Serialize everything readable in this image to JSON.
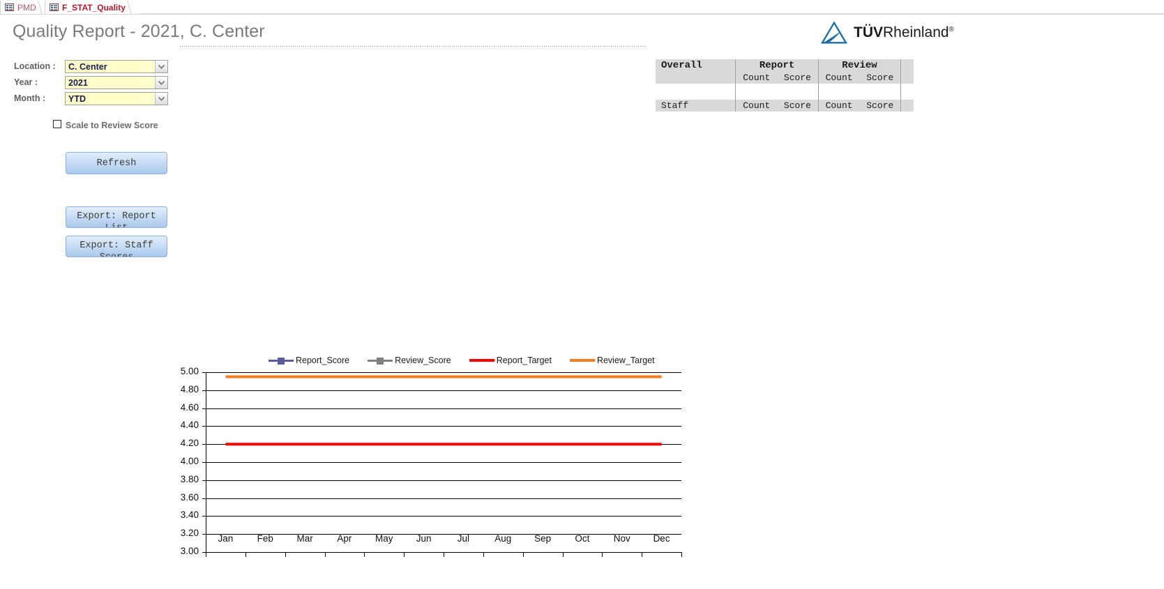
{
  "tabs": [
    {
      "label": "PMD",
      "active": false,
      "icon": "form-icon"
    },
    {
      "label": "F_STAT_Quality",
      "active": true,
      "icon": "form-icon"
    }
  ],
  "header": {
    "title": "Quality Report - 2021, C. Center",
    "logo_text_bold": "TÜV",
    "logo_text_rest": "Rheinland",
    "logo_registered": "®",
    "logo_color": "#1b6ca8"
  },
  "form": {
    "location_label": "Location :",
    "location_value": "C. Center",
    "year_label": "Year :",
    "year_value": "2021",
    "month_label": "Month :",
    "month_value": "YTD",
    "scale_checkbox_label": "Scale to Review Score",
    "scale_checked": false,
    "refresh_label": "Refresh",
    "export_report_label": "Export: Report List",
    "export_staff_label": "Export: Staff Scores"
  },
  "tables": {
    "overall": {
      "name": "Overall",
      "group_report": "Report",
      "group_review": "Review",
      "sub_report_count": "Count",
      "sub_report_score": "Score",
      "sub_review_count": "Count",
      "sub_review_score": "Score",
      "values": {
        "report_count": "",
        "report_score": "",
        "review_count": "",
        "review_score": ""
      }
    },
    "staff": {
      "name": "Staff",
      "sub_report_count": "Count",
      "sub_report_score": "Score",
      "sub_review_count": "Count",
      "sub_review_score": "Score"
    }
  },
  "chart_data": {
    "type": "line",
    "title": "",
    "xlabel": "",
    "ylabel": "",
    "categories": [
      "Jan",
      "Feb",
      "Mar",
      "Apr",
      "May",
      "Jun",
      "Jul",
      "Aug",
      "Sep",
      "Oct",
      "Nov",
      "Dec"
    ],
    "ylim": [
      3.0,
      5.0
    ],
    "ytick_labels": [
      "5.00",
      "4.80",
      "4.60",
      "4.40",
      "4.20",
      "4.00",
      "3.80",
      "3.60",
      "3.40",
      "3.20",
      "3.00"
    ],
    "ytick_values": [
      5.0,
      4.8,
      4.6,
      4.4,
      4.2,
      4.0,
      3.8,
      3.6,
      3.4,
      3.2,
      3.0
    ],
    "grid": true,
    "legend_position": "top",
    "series": [
      {
        "name": "Report_Score",
        "color": "#5b5b9e",
        "marker": "square",
        "values": [
          null,
          null,
          null,
          null,
          null,
          null,
          null,
          null,
          null,
          null,
          null,
          null
        ]
      },
      {
        "name": "Review_Score",
        "color": "#808080",
        "marker": "square",
        "values": [
          null,
          null,
          null,
          null,
          null,
          null,
          null,
          null,
          null,
          null,
          null,
          null
        ]
      },
      {
        "name": "Report_Target",
        "color": "#ff0000",
        "marker": "none",
        "values": [
          4.2,
          4.2,
          4.2,
          4.2,
          4.2,
          4.2,
          4.2,
          4.2,
          4.2,
          4.2,
          4.2,
          4.2
        ]
      },
      {
        "name": "Review_Target",
        "color": "#f57c1f",
        "marker": "none",
        "values": [
          4.95,
          4.95,
          4.95,
          4.95,
          4.95,
          4.95,
          4.95,
          4.95,
          4.95,
          4.95,
          4.95,
          4.95
        ]
      }
    ]
  }
}
